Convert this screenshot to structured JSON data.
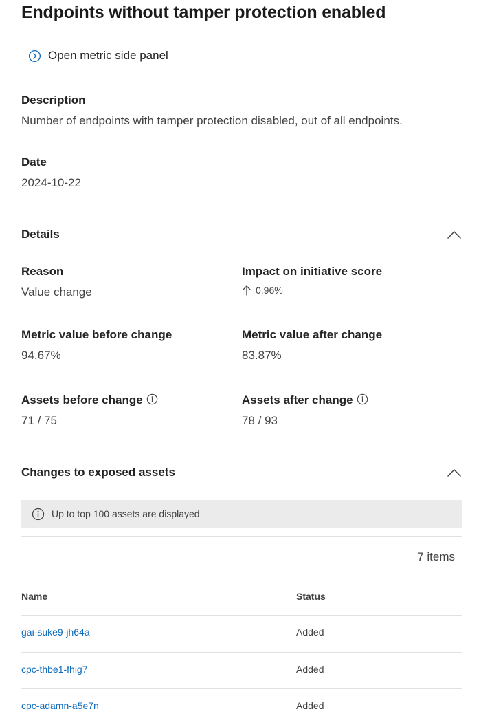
{
  "title": "Endpoints without tamper protection enabled",
  "side_panel_link": "Open metric side panel",
  "description": {
    "label": "Description",
    "value": "Number of endpoints with tamper protection disabled, out of all endpoints."
  },
  "date": {
    "label": "Date",
    "value": "2024-10-22"
  },
  "details": {
    "heading": "Details",
    "reason_label": "Reason",
    "reason_value": "Value change",
    "impact_label": "Impact on initiative score",
    "impact_value": "0.96%",
    "impact_direction": "up",
    "metric_before_label": "Metric value before change",
    "metric_before_value": "94.67%",
    "metric_after_label": "Metric value after change",
    "metric_after_value": "83.87%",
    "assets_before_label": "Assets before change",
    "assets_before_value": "71 / 75",
    "assets_after_label": "Assets after change",
    "assets_after_value": "78 / 93"
  },
  "changes": {
    "heading": "Changes to exposed assets",
    "banner": "Up to top 100 assets are displayed",
    "items_count": "7 items",
    "columns": {
      "name": "Name",
      "status": "Status"
    },
    "rows": [
      {
        "name": "gai-suke9-jh64a",
        "status": "Added"
      },
      {
        "name": "cpc-thbe1-fhig7",
        "status": "Added"
      },
      {
        "name": "cpc-adamn-a5e7n",
        "status": "Added"
      }
    ]
  },
  "colors": {
    "link": "#0f6cbd",
    "banner_bg": "#ebebeb",
    "divider": "#e1e1e1"
  }
}
